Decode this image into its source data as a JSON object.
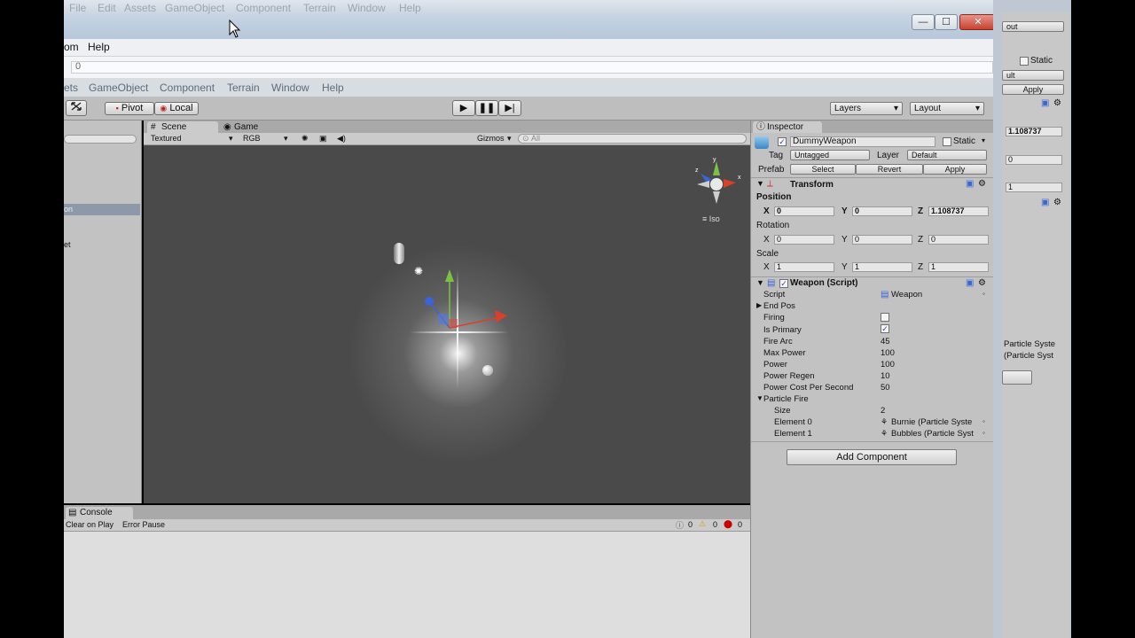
{
  "bg_menubar": {
    "items": [
      "File",
      "Edit",
      "Assets",
      "GameObject",
      "Component",
      "Terrain",
      "Window",
      "Help"
    ]
  },
  "window_controls": {
    "minimize": "—",
    "maximize": "☐",
    "close": "✕"
  },
  "menubar2": {
    "items": [
      "om",
      "Help"
    ]
  },
  "urlbar": {
    "value": "0"
  },
  "unity_menu": {
    "items": [
      "ets",
      "GameObject",
      "Component",
      "Terrain",
      "Window",
      "Help"
    ]
  },
  "toolbar": {
    "pivot": "Pivot",
    "local": "Local",
    "layers": "Layers",
    "layout": "Layout"
  },
  "hierarchy": {
    "selected_item": "on",
    "item2": "et"
  },
  "scene": {
    "tab_scene": "Scene",
    "tab_game": "Game",
    "render_mode": "Textured",
    "color_mode": "RGB",
    "gizmos": "Gizmos",
    "search_placeholder": "All",
    "projection": "Iso"
  },
  "console": {
    "tab": "Console",
    "clear_on_play": "Clear on Play",
    "error_pause": "Error Pause",
    "log_count": "0",
    "warn_count": "0",
    "error_count": "0"
  },
  "inspector": {
    "tab": "Inspector",
    "object_name": "DummyWeapon",
    "static_label": "Static",
    "tag_label": "Tag",
    "tag_value": "Untagged",
    "layer_label": "Layer",
    "layer_value": "Default",
    "prefab_label": "Prefab",
    "select": "Select",
    "revert": "Revert",
    "apply": "Apply",
    "transform": {
      "title": "Transform",
      "position_label": "Position",
      "rotation_label": "Rotation",
      "scale_label": "Scale",
      "x_label": "X",
      "y_label": "Y",
      "z_label": "Z",
      "position": {
        "x": "0",
        "y": "0",
        "z": "1.108737"
      },
      "rotation": {
        "x": "0",
        "y": "0",
        "z": "0"
      },
      "scale": {
        "x": "1",
        "y": "1",
        "z": "1"
      }
    },
    "weapon": {
      "title": "Weapon (Script)",
      "fields": [
        {
          "label": "Script",
          "value": "Weapon"
        },
        {
          "label": "End Pos",
          "value": ""
        },
        {
          "label": "Firing",
          "value": ""
        },
        {
          "label": "Is Primary",
          "value": "✓"
        },
        {
          "label": "Fire Arc",
          "value": "45"
        },
        {
          "label": "Max Power",
          "value": "100"
        },
        {
          "label": "Power",
          "value": "100"
        },
        {
          "label": "Power Regen",
          "value": "10"
        },
        {
          "label": "Power Cost Per Second",
          "value": "50"
        },
        {
          "label": "Particle Fire",
          "value": ""
        },
        {
          "label": "Size",
          "value": "2"
        },
        {
          "label": "Element 0",
          "value": "Burnie (Particle Syste"
        },
        {
          "label": "Element 1",
          "value": "Bubbles (Particle Syst"
        }
      ]
    },
    "add_component": "Add Component"
  },
  "right_window": {
    "dropdown1": "out",
    "static_label": "Static",
    "dropdown2": "ult",
    "apply": "Apply",
    "value1": "1.108737",
    "value2": "0",
    "value3": "1",
    "elem0": "Particle Syste",
    "elem1": "(Particle Syst"
  }
}
